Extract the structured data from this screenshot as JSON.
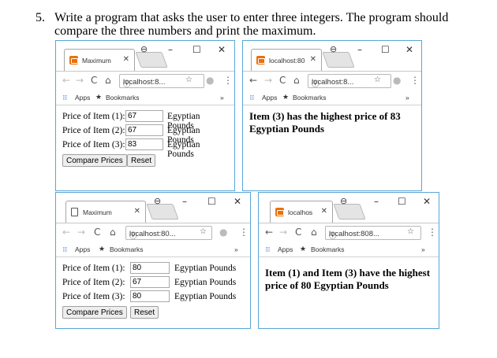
{
  "question": {
    "number": "5.",
    "text": "Write a program that asks the user to enter three integers. The program should compare the three numbers and print the maximum."
  },
  "windows": [
    {
      "tab_title": "Maximum",
      "url": "localhost:8...",
      "apps_label": "Apps",
      "bookmarks_label": "Bookmarks",
      "form": {
        "labels": [
          "Price of Item (1):",
          "Price of Item (2):",
          "Price of Item (3):"
        ],
        "values": [
          "67",
          "67",
          "83"
        ],
        "unit": "Egyptian Pounds",
        "compare_label": "Compare Prices",
        "reset_label": "Reset"
      }
    },
    {
      "tab_title": "localhost:80",
      "url": "localhost:8...",
      "apps_label": "Apps",
      "bookmarks_label": "Bookmarks",
      "result": "Item (3) has the highest price of 83 Egyptian Pounds"
    },
    {
      "tab_title": "Maximum",
      "url": "localhost:80...",
      "apps_label": "Apps",
      "bookmarks_label": "Bookmarks",
      "form": {
        "labels": [
          "Price of Item (1):",
          "Price of Item (2):",
          "Price of Item (3):"
        ],
        "values": [
          "80",
          "67",
          "80"
        ],
        "unit": "Egyptian Pounds",
        "compare_label": "Compare Prices",
        "reset_label": "Reset"
      }
    },
    {
      "tab_title": "localhos",
      "url": "localhost:808...",
      "apps_label": "Apps",
      "bookmarks_label": "Bookmarks",
      "result": "Item (1) and Item (3) have the highest price of 80 Egyptian Pounds"
    }
  ],
  "icons": {
    "back": "arrow-left-icon",
    "forward": "arrow-right-icon",
    "reload": "reload-icon",
    "home": "home-icon",
    "info": "info-icon",
    "star": "star-icon",
    "extension": "extension-icon",
    "menu": "kebab-menu-icon",
    "profile": "profile-icon",
    "minimize": "minimize-icon",
    "maximize": "maximize-icon",
    "close": "close-icon",
    "apps": "apps-grid-icon",
    "bookmark": "bookmark-star-icon",
    "more": "chevron-double-right-icon"
  },
  "colors": {
    "window_border": "#5aa6d6",
    "favicon": "#e8710a",
    "apps_icon": "#4a7bd0"
  }
}
